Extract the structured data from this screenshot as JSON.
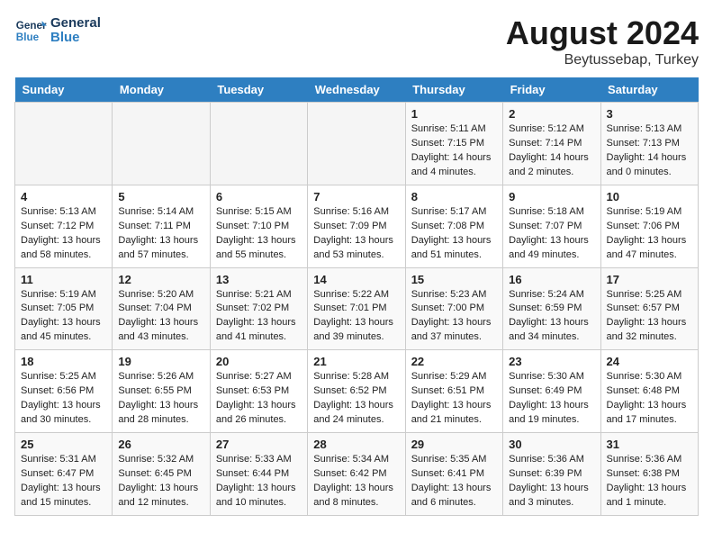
{
  "header": {
    "logo_line1": "General",
    "logo_line2": "Blue",
    "month_year": "August 2024",
    "location": "Beytussebap, Turkey"
  },
  "days_of_week": [
    "Sunday",
    "Monday",
    "Tuesday",
    "Wednesday",
    "Thursday",
    "Friday",
    "Saturday"
  ],
  "weeks": [
    [
      {
        "day": "",
        "empty": true
      },
      {
        "day": "",
        "empty": true
      },
      {
        "day": "",
        "empty": true
      },
      {
        "day": "",
        "empty": true
      },
      {
        "day": "1",
        "sunrise": "5:11 AM",
        "sunset": "7:15 PM",
        "daylight": "14 hours and 4 minutes."
      },
      {
        "day": "2",
        "sunrise": "5:12 AM",
        "sunset": "7:14 PM",
        "daylight": "14 hours and 2 minutes."
      },
      {
        "day": "3",
        "sunrise": "5:13 AM",
        "sunset": "7:13 PM",
        "daylight": "14 hours and 0 minutes."
      }
    ],
    [
      {
        "day": "4",
        "sunrise": "5:13 AM",
        "sunset": "7:12 PM",
        "daylight": "13 hours and 58 minutes."
      },
      {
        "day": "5",
        "sunrise": "5:14 AM",
        "sunset": "7:11 PM",
        "daylight": "13 hours and 57 minutes."
      },
      {
        "day": "6",
        "sunrise": "5:15 AM",
        "sunset": "7:10 PM",
        "daylight": "13 hours and 55 minutes."
      },
      {
        "day": "7",
        "sunrise": "5:16 AM",
        "sunset": "7:09 PM",
        "daylight": "13 hours and 53 minutes."
      },
      {
        "day": "8",
        "sunrise": "5:17 AM",
        "sunset": "7:08 PM",
        "daylight": "13 hours and 51 minutes."
      },
      {
        "day": "9",
        "sunrise": "5:18 AM",
        "sunset": "7:07 PM",
        "daylight": "13 hours and 49 minutes."
      },
      {
        "day": "10",
        "sunrise": "5:19 AM",
        "sunset": "7:06 PM",
        "daylight": "13 hours and 47 minutes."
      }
    ],
    [
      {
        "day": "11",
        "sunrise": "5:19 AM",
        "sunset": "7:05 PM",
        "daylight": "13 hours and 45 minutes."
      },
      {
        "day": "12",
        "sunrise": "5:20 AM",
        "sunset": "7:04 PM",
        "daylight": "13 hours and 43 minutes."
      },
      {
        "day": "13",
        "sunrise": "5:21 AM",
        "sunset": "7:02 PM",
        "daylight": "13 hours and 41 minutes."
      },
      {
        "day": "14",
        "sunrise": "5:22 AM",
        "sunset": "7:01 PM",
        "daylight": "13 hours and 39 minutes."
      },
      {
        "day": "15",
        "sunrise": "5:23 AM",
        "sunset": "7:00 PM",
        "daylight": "13 hours and 37 minutes."
      },
      {
        "day": "16",
        "sunrise": "5:24 AM",
        "sunset": "6:59 PM",
        "daylight": "13 hours and 34 minutes."
      },
      {
        "day": "17",
        "sunrise": "5:25 AM",
        "sunset": "6:57 PM",
        "daylight": "13 hours and 32 minutes."
      }
    ],
    [
      {
        "day": "18",
        "sunrise": "5:25 AM",
        "sunset": "6:56 PM",
        "daylight": "13 hours and 30 minutes."
      },
      {
        "day": "19",
        "sunrise": "5:26 AM",
        "sunset": "6:55 PM",
        "daylight": "13 hours and 28 minutes."
      },
      {
        "day": "20",
        "sunrise": "5:27 AM",
        "sunset": "6:53 PM",
        "daylight": "13 hours and 26 minutes."
      },
      {
        "day": "21",
        "sunrise": "5:28 AM",
        "sunset": "6:52 PM",
        "daylight": "13 hours and 24 minutes."
      },
      {
        "day": "22",
        "sunrise": "5:29 AM",
        "sunset": "6:51 PM",
        "daylight": "13 hours and 21 minutes."
      },
      {
        "day": "23",
        "sunrise": "5:30 AM",
        "sunset": "6:49 PM",
        "daylight": "13 hours and 19 minutes."
      },
      {
        "day": "24",
        "sunrise": "5:30 AM",
        "sunset": "6:48 PM",
        "daylight": "13 hours and 17 minutes."
      }
    ],
    [
      {
        "day": "25",
        "sunrise": "5:31 AM",
        "sunset": "6:47 PM",
        "daylight": "13 hours and 15 minutes."
      },
      {
        "day": "26",
        "sunrise": "5:32 AM",
        "sunset": "6:45 PM",
        "daylight": "13 hours and 12 minutes."
      },
      {
        "day": "27",
        "sunrise": "5:33 AM",
        "sunset": "6:44 PM",
        "daylight": "13 hours and 10 minutes."
      },
      {
        "day": "28",
        "sunrise": "5:34 AM",
        "sunset": "6:42 PM",
        "daylight": "13 hours and 8 minutes."
      },
      {
        "day": "29",
        "sunrise": "5:35 AM",
        "sunset": "6:41 PM",
        "daylight": "13 hours and 6 minutes."
      },
      {
        "day": "30",
        "sunrise": "5:36 AM",
        "sunset": "6:39 PM",
        "daylight": "13 hours and 3 minutes."
      },
      {
        "day": "31",
        "sunrise": "5:36 AM",
        "sunset": "6:38 PM",
        "daylight": "13 hours and 1 minute."
      }
    ]
  ]
}
